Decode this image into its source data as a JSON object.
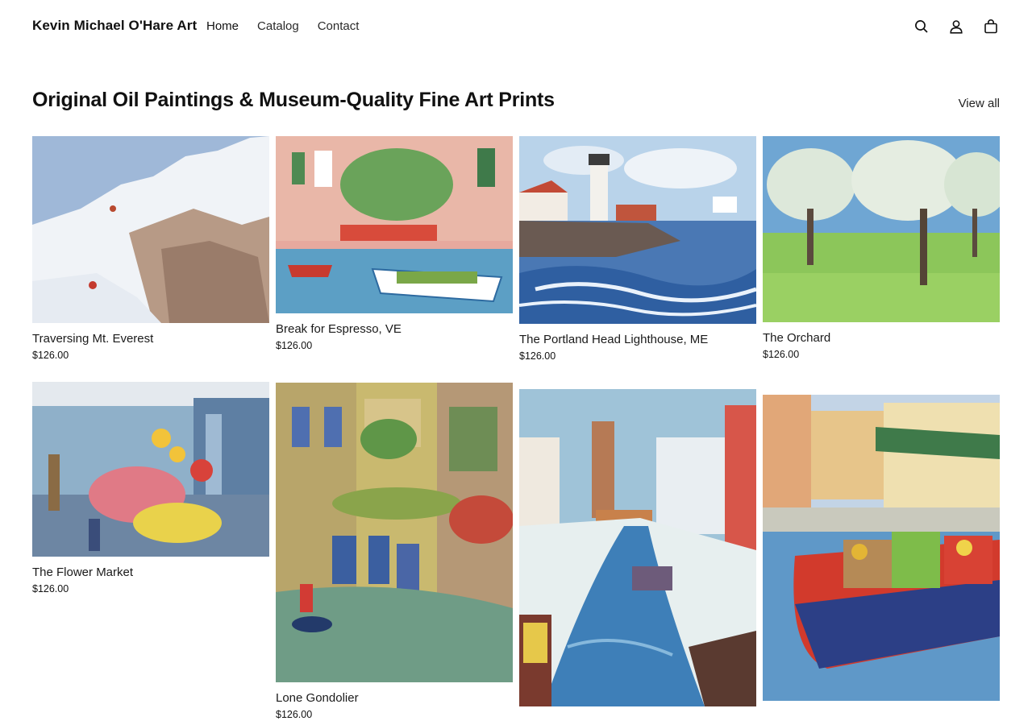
{
  "header": {
    "brand": "Kevin Michael O'Hare Art",
    "nav": [
      {
        "label": "Home"
      },
      {
        "label": "Catalog"
      },
      {
        "label": "Contact"
      }
    ],
    "icons": [
      "search-icon",
      "account-icon",
      "cart-icon"
    ]
  },
  "collection": {
    "title": "Original Oil Paintings & Museum-Quality Fine Art Prints",
    "view_all": "View all"
  },
  "products": [
    {
      "title": "Traversing Mt. Everest",
      "price": "$126.00"
    },
    {
      "title": "Break for Espresso, VE",
      "price": "$126.00"
    },
    {
      "title": "The Portland Head Lighthouse, ME",
      "price": "$126.00"
    },
    {
      "title": "The Orchard",
      "price": "$126.00"
    },
    {
      "title": "The Flower Market",
      "price": "$126.00"
    },
    {
      "title": "Lone Gondolier",
      "price": "$126.00"
    },
    {
      "title": "",
      "price": ""
    },
    {
      "title": "",
      "price": ""
    }
  ]
}
